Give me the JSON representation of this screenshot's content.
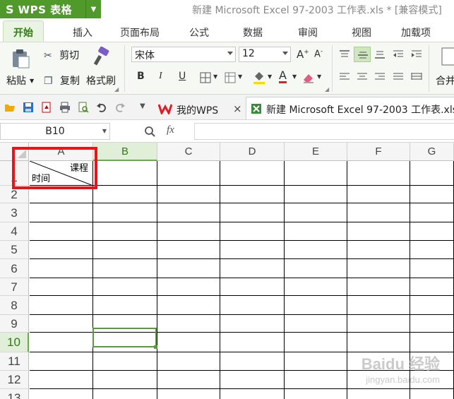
{
  "titlebar": {
    "logo_glyph": "S",
    "app_name": "WPS 表格",
    "dropdown_glyph": "▼",
    "doc_title": "新建 Microsoft Excel 97-2003 工作表.xls * [兼容模式]"
  },
  "tabs": [
    "开始",
    "插入",
    "页面布局",
    "公式",
    "数据",
    "审阅",
    "视图",
    "加载项"
  ],
  "ribbon": {
    "paste": "粘贴",
    "cut": "剪切",
    "copy": "复制",
    "format_painter": "格式刷",
    "font_name": "宋体",
    "font_size": "12",
    "bold": "B",
    "italic": "I",
    "underline": "U",
    "merge": "合并"
  },
  "doc_tabs": {
    "mywps": "我的WPS",
    "doc": "新建 Microsoft Excel 97-2003 工作表.xls",
    "close_glyph": "×"
  },
  "formula_bar": {
    "namebox": "B10",
    "fx": "fx"
  },
  "grid": {
    "columns": [
      "A",
      "B",
      "C",
      "D",
      "E",
      "F",
      "G"
    ],
    "rows": [
      "1",
      "2",
      "3",
      "4",
      "5",
      "6",
      "7",
      "8",
      "9",
      "10",
      "11",
      "12",
      "13"
    ],
    "selected_column": "B",
    "selected_row": "10",
    "a1_top_text": "课程",
    "a1_bottom_text": "时间"
  },
  "watermark": {
    "main": "Baidu 经验",
    "sub": "jingyan.baidu.com"
  },
  "colors": {
    "accent": "#4f9a2a",
    "annotation": "#e8141c",
    "selection": "#5b9b3c"
  }
}
